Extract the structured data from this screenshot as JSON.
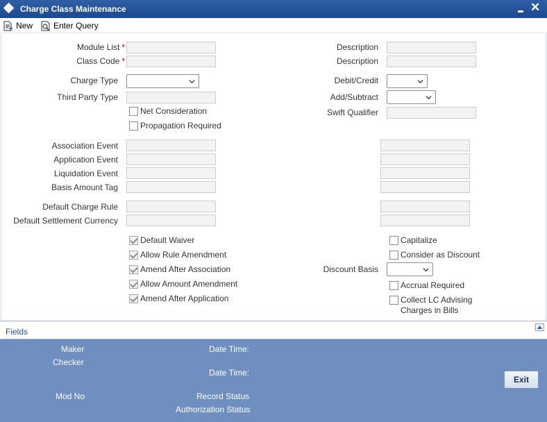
{
  "window": {
    "title": "Charge Class Maintenance"
  },
  "toolbar": {
    "new_label": "New",
    "enter_query_label": "Enter Query"
  },
  "form": {
    "module_list": {
      "label": "Module List",
      "required": "*",
      "value": ""
    },
    "class_code": {
      "label": "Class Code",
      "required": "*",
      "value": ""
    },
    "description1": {
      "label": "Description",
      "value": ""
    },
    "description2": {
      "label": "Description",
      "value": ""
    },
    "charge_type": {
      "label": "Charge Type",
      "value": ""
    },
    "debit_credit": {
      "label": "Debit/Credit",
      "value": ""
    },
    "third_party_type": {
      "label": "Third Party Type",
      "value": ""
    },
    "add_subtract": {
      "label": "Add/Subtract",
      "value": ""
    },
    "net_consideration": {
      "label": "Net Consideration",
      "checked": false
    },
    "swift_qualifier": {
      "label": "Swift Qualifier",
      "value": ""
    },
    "propagation_required": {
      "label": "Propagation Required",
      "checked": false
    },
    "association_event": {
      "label": "Association Event",
      "value": "",
      "desc": ""
    },
    "application_event": {
      "label": "Application Event",
      "value": "",
      "desc": ""
    },
    "liquidation_event": {
      "label": "Liquidation Event",
      "value": "",
      "desc": ""
    },
    "basis_amount_tag": {
      "label": "Basis Amount Tag",
      "value": "",
      "desc": ""
    },
    "default_charge_rule": {
      "label": "Default Charge Rule",
      "value": "",
      "desc": ""
    },
    "default_settlement_currency": {
      "label": "Default Settlement Currency",
      "value": "",
      "desc": ""
    },
    "default_waiver": {
      "label": "Default Waiver",
      "checked": true
    },
    "allow_rule_amendment": {
      "label": "Allow Rule Amendment",
      "checked": true
    },
    "amend_after_association": {
      "label": "Amend After Association",
      "checked": true
    },
    "allow_amount_amendment": {
      "label": "Allow Amount Amendment",
      "checked": true
    },
    "amend_after_application": {
      "label": "Amend After Application",
      "checked": true
    },
    "capitalize": {
      "label": "Capitalize",
      "checked": false
    },
    "consider_as_discount": {
      "label": "Consider as Discount",
      "checked": false
    },
    "discount_basis": {
      "label": "Discount Basis",
      "value": ""
    },
    "accrual_required": {
      "label": "Accrual Required",
      "checked": false
    },
    "collect_lc_advising": {
      "label_line1": "Collect LC Advising",
      "label_line2": "Charges in Bills",
      "checked": false
    }
  },
  "fields_bar": {
    "label": "Fields"
  },
  "footer": {
    "maker": "Maker",
    "checker": "Checker",
    "date_time_1": "Date Time:",
    "date_time_2": "Date Time:",
    "mod_no": "Mod No",
    "record_status": "Record Status",
    "authorization_status": "Authorization Status",
    "exit_label": "Exit"
  },
  "colors": {
    "titlebar": "#1c4a8f",
    "footer": "#6f8fc0",
    "required": "#cc0000",
    "link": "#1f4d97"
  },
  "icons": {
    "title": "diamond-icon",
    "new": "new-document-icon",
    "enter_query": "query-icon",
    "minimize": "minimize-icon",
    "close": "close-icon",
    "collapse": "collapse-up-icon"
  }
}
